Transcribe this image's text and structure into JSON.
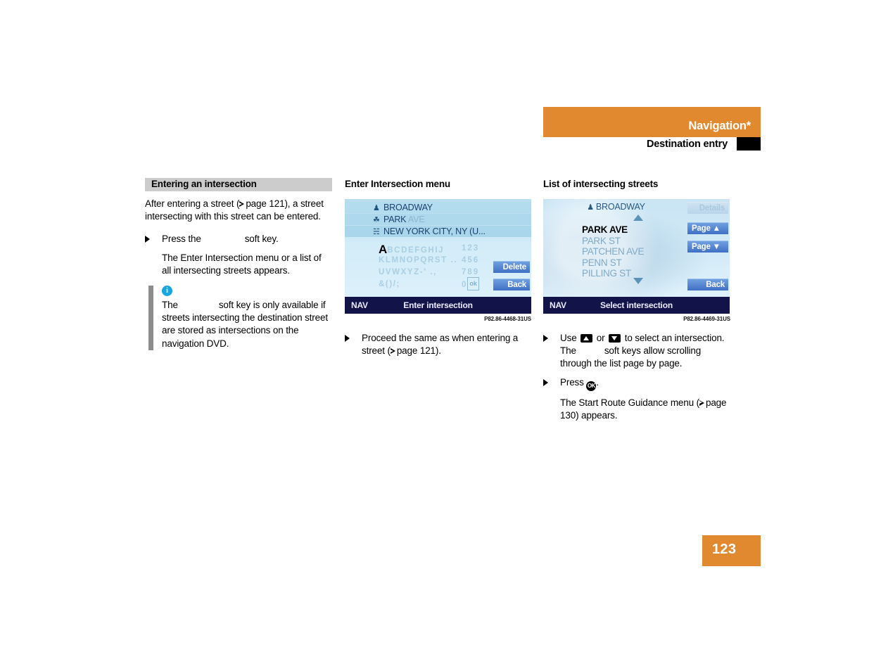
{
  "header": {
    "title": "Navigation*",
    "subtitle": "Destination entry",
    "band_color": "#e0892f",
    "tab_color": "#000000"
  },
  "page_number": "123",
  "left_column": {
    "heading": "Entering an intersection",
    "intro_before_ref": "After entering a street (",
    "intro_ref": "page 121",
    "intro_after_ref": "), a street intersecting with this street can be entered.",
    "step_prefix": "Press the",
    "step_suffix": "soft key.",
    "step_result": "The Enter Intersection menu or a list of all intersecting streets appears.",
    "note": {
      "icon": "info-icon",
      "icon_glyph": "i",
      "text_prefix": "The",
      "text_suffix": "soft key is only available if streets intersecting the destination street are stored as intersections on the navigation DVD."
    }
  },
  "middle_column": {
    "heading": "Enter Intersection menu",
    "caption": "P82.86-4468-31US",
    "screen": {
      "destination_rows": [
        {
          "glyph": "flag-icon",
          "glyph_char": "♟",
          "text": "BROADWAY",
          "dim_text": ""
        },
        {
          "glyph": "street-icon",
          "glyph_char": "☘",
          "text": "PARK ",
          "dim_text": "AVE"
        },
        {
          "glyph": "city-icon",
          "glyph_char": "☵",
          "text": "NEW YORK CITY, NY (U...",
          "dim_text": ""
        }
      ],
      "keypad_rows": [
        {
          "letters": "ABCDEFGHIJ",
          "numbers": "123"
        },
        {
          "letters": "KLMNOPQRST .. ",
          "numbers": "456"
        },
        {
          "letters": "UVWXYZ-' .,",
          "numbers": "789"
        },
        {
          "letters": "&()/;",
          "numbers": "0"
        }
      ],
      "active_key": "A",
      "ok_key": "ok",
      "soft_keys": [
        {
          "label": "Delete",
          "state": "enabled"
        },
        {
          "label": "Back",
          "state": "enabled"
        }
      ],
      "status_left": "NAV",
      "status_title": "Enter intersection"
    },
    "body_step_before_ref": "Proceed the same as when entering a street (",
    "body_step_ref": "page 121",
    "body_step_after_ref": ")."
  },
  "right_column": {
    "heading": "List of intersecting streets",
    "caption": "P82.86-4469-31US",
    "screen": {
      "header_glyph": "flag-icon",
      "header_glyph_char": "♟",
      "header_text": "BROADWAY",
      "scroll_up_icon": "triangle-up-icon",
      "scroll_down_icon": "triangle-down-icon",
      "list": [
        {
          "label": "PARK AVE",
          "selected": true
        },
        {
          "label": "PARK ST",
          "selected": false
        },
        {
          "label": "PATCHEN AVE",
          "selected": false
        },
        {
          "label": "PENN ST",
          "selected": false
        },
        {
          "label": "PILLING ST",
          "selected": false
        }
      ],
      "soft_keys": [
        {
          "label": "Details",
          "state": "disabled"
        },
        {
          "label": "Page ▲",
          "state": "enabled"
        },
        {
          "label": "Page ▼",
          "state": "enabled"
        },
        {
          "label": "Back",
          "state": "enabled"
        }
      ],
      "status_left": "NAV",
      "status_title": "Select intersection"
    },
    "step1_a": "Use",
    "step1_b": "or",
    "step1_c": "to select an intersection. The",
    "step1_d": "soft keys allow scrolling through the list page by page.",
    "step2_a": "Press",
    "step2_ok": "OK",
    "step2_b": ".",
    "step2_result_before_ref": "The Start Route Guidance menu (",
    "step2_result_ref": "page 130",
    "step2_result_after_ref": ") appears."
  }
}
